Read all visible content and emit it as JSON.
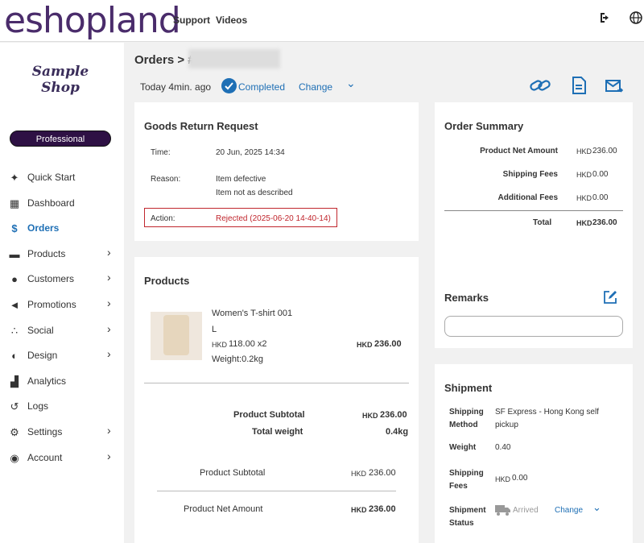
{
  "header": {
    "logo": "eshopland",
    "links": [
      "Support",
      "Videos"
    ],
    "icons": [
      "logout-icon",
      "globe-icon"
    ]
  },
  "sidebar": {
    "shop_name": "Sample Shop",
    "plan": "Professional",
    "items": [
      {
        "label": "Quick Start",
        "icon": "magic-wand-icon",
        "expandable": false,
        "active": false
      },
      {
        "label": "Dashboard",
        "icon": "dashboard-icon",
        "expandable": false,
        "active": false
      },
      {
        "label": "Orders",
        "icon": "orders-icon",
        "expandable": false,
        "active": true
      },
      {
        "label": "Products",
        "icon": "box-icon",
        "expandable": true,
        "active": false
      },
      {
        "label": "Customers",
        "icon": "user-icon",
        "expandable": true,
        "active": false
      },
      {
        "label": "Promotions",
        "icon": "megaphone-icon",
        "expandable": true,
        "active": false
      },
      {
        "label": "Social",
        "icon": "share-icon",
        "expandable": true,
        "active": false
      },
      {
        "label": "Design",
        "icon": "palette-icon",
        "expandable": true,
        "active": false
      },
      {
        "label": "Analytics",
        "icon": "chart-icon",
        "expandable": false,
        "active": false
      },
      {
        "label": "Logs",
        "icon": "history-icon",
        "expandable": false,
        "active": false
      },
      {
        "label": "Settings",
        "icon": "gears-icon",
        "expandable": true,
        "active": false
      },
      {
        "label": "Account",
        "icon": "account-icon",
        "expandable": true,
        "active": false
      }
    ]
  },
  "order": {
    "breadcrumb": "Orders > #",
    "time": "Today 4min. ago",
    "status": "Completed",
    "change": "Change",
    "chevron": "⌄",
    "action_icons": [
      "link-icon",
      "document-icon",
      "email-icon"
    ]
  },
  "goods_return": {
    "title": "Goods Return Request",
    "time_label": "Time:",
    "time_value": "20 Jun, 2025 14:34",
    "reason_label": "Reason:",
    "reasons": [
      "Item defective",
      "Item not as described"
    ],
    "action_label": "Action:",
    "action_value": "Rejected (2025-06-20 14-40-14)"
  },
  "products": {
    "title": "Products",
    "item": {
      "name": "Women's T-shirt 001",
      "size": "L",
      "currency": "HKD",
      "price": "118.00 x2",
      "total": "236.00",
      "weight": "Weight:0.2kg"
    },
    "subtotal_label": "Product Subtotal",
    "subtotal_value": "236.00",
    "weight_label": "Total weight",
    "weight_value": "0.4kg",
    "subtotal2_label": "Product Subtotal",
    "subtotal2_value": "236.00",
    "net_label": "Product Net Amount",
    "net_value": "236.00"
  },
  "summary": {
    "title": "Order Summary",
    "rows": [
      {
        "label": "Product Net Amount",
        "cur": "HKD",
        "value": "236.00"
      },
      {
        "label": "Shipping Fees",
        "cur": "HKD",
        "value": "0.00"
      },
      {
        "label": "Additional Fees",
        "cur": "HKD",
        "value": "0.00"
      }
    ],
    "total_label": "Total",
    "total_cur": "HKD",
    "total_value": "236.00"
  },
  "remarks": {
    "title": "Remarks",
    "placeholder": ""
  },
  "shipment": {
    "title": "Shipment",
    "method_label": "Shipping Method",
    "method_value": "SF Express - Hong Kong self pickup",
    "weight_label": "Weight",
    "weight_value": "0.40",
    "fees_label": "Shipping Fees",
    "fees_cur": "HKD",
    "fees_value": "0.00",
    "status_label": "Shipment Status",
    "status_value": "Arrived",
    "change": "Change"
  }
}
